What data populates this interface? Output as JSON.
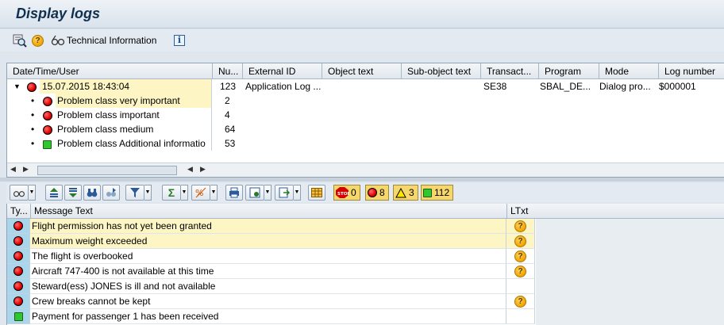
{
  "title": "Display logs",
  "app_toolbar": {
    "technical_information": "Technical Information"
  },
  "tree": {
    "columns": [
      "Date/Time/User",
      "Nu...",
      "External ID",
      "Object text",
      "Sub-object text",
      "Transact...",
      "Program",
      "Mode",
      "Log number"
    ],
    "log": {
      "datetime": "15.07.2015  18:43:04",
      "number": "123",
      "external_id": "Application Log ...",
      "object_text": "",
      "subobject_text": "",
      "transaction": "SE38",
      "program": "SBAL_DE...",
      "mode": "Dialog pro...",
      "log_number": "$000001"
    },
    "children": [
      {
        "label": "Problem class very important",
        "count": "2",
        "status": "red"
      },
      {
        "label": "Problem class important",
        "count": "4",
        "status": "red"
      },
      {
        "label": "Problem class medium",
        "count": "64",
        "status": "red"
      },
      {
        "label": "Problem class Additional informatio",
        "count": "53",
        "status": "green"
      }
    ]
  },
  "alv_toolbar": {
    "stop_count": "0",
    "error_count": "8",
    "warning_count": "3",
    "success_count": "112"
  },
  "grid": {
    "columns": {
      "type": "Ty...",
      "text": "Message Text",
      "ltxt": "LTxt"
    },
    "rows": [
      {
        "status": "red",
        "text": "Flight permission has not yet been granted",
        "ltxt": true,
        "highlight": true
      },
      {
        "status": "red",
        "text": "Maximum weight exceeded",
        "ltxt": true,
        "highlight": true
      },
      {
        "status": "red",
        "text": "The flight is overbooked",
        "ltxt": true,
        "highlight": false
      },
      {
        "status": "red",
        "text": "Aircraft 747-400 is not available at this time",
        "ltxt": true,
        "highlight": false
      },
      {
        "status": "red",
        "text": "Steward(ess) JONES is ill and not available",
        "ltxt": false,
        "highlight": false
      },
      {
        "status": "red",
        "text": "Crew breaks cannot be kept",
        "ltxt": true,
        "highlight": false
      },
      {
        "status": "green",
        "text": "Payment for passenger 1 has been received",
        "ltxt": false,
        "highlight": false
      }
    ]
  }
}
